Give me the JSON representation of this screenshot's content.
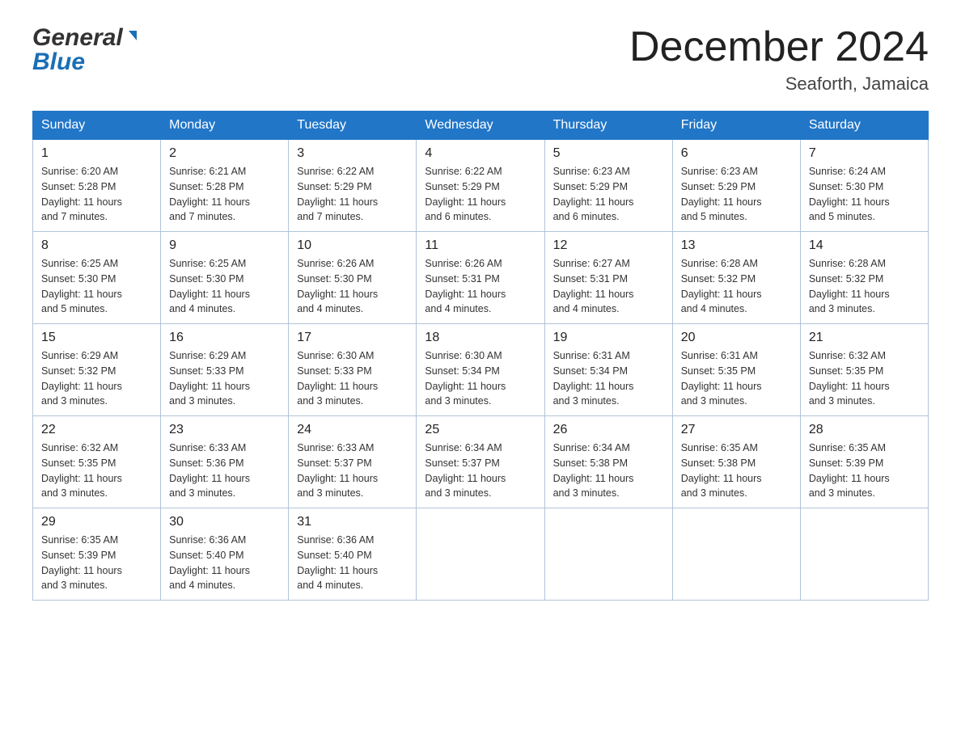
{
  "header": {
    "logo_general": "General",
    "logo_blue": "Blue",
    "title": "December 2024",
    "location": "Seaforth, Jamaica"
  },
  "days_of_week": [
    "Sunday",
    "Monday",
    "Tuesday",
    "Wednesday",
    "Thursday",
    "Friday",
    "Saturday"
  ],
  "weeks": [
    [
      {
        "day": "1",
        "sunrise": "6:20 AM",
        "sunset": "5:28 PM",
        "daylight": "11 hours and 7 minutes."
      },
      {
        "day": "2",
        "sunrise": "6:21 AM",
        "sunset": "5:28 PM",
        "daylight": "11 hours and 7 minutes."
      },
      {
        "day": "3",
        "sunrise": "6:22 AM",
        "sunset": "5:29 PM",
        "daylight": "11 hours and 7 minutes."
      },
      {
        "day": "4",
        "sunrise": "6:22 AM",
        "sunset": "5:29 PM",
        "daylight": "11 hours and 6 minutes."
      },
      {
        "day": "5",
        "sunrise": "6:23 AM",
        "sunset": "5:29 PM",
        "daylight": "11 hours and 6 minutes."
      },
      {
        "day": "6",
        "sunrise": "6:23 AM",
        "sunset": "5:29 PM",
        "daylight": "11 hours and 5 minutes."
      },
      {
        "day": "7",
        "sunrise": "6:24 AM",
        "sunset": "5:30 PM",
        "daylight": "11 hours and 5 minutes."
      }
    ],
    [
      {
        "day": "8",
        "sunrise": "6:25 AM",
        "sunset": "5:30 PM",
        "daylight": "11 hours and 5 minutes."
      },
      {
        "day": "9",
        "sunrise": "6:25 AM",
        "sunset": "5:30 PM",
        "daylight": "11 hours and 4 minutes."
      },
      {
        "day": "10",
        "sunrise": "6:26 AM",
        "sunset": "5:30 PM",
        "daylight": "11 hours and 4 minutes."
      },
      {
        "day": "11",
        "sunrise": "6:26 AM",
        "sunset": "5:31 PM",
        "daylight": "11 hours and 4 minutes."
      },
      {
        "day": "12",
        "sunrise": "6:27 AM",
        "sunset": "5:31 PM",
        "daylight": "11 hours and 4 minutes."
      },
      {
        "day": "13",
        "sunrise": "6:28 AM",
        "sunset": "5:32 PM",
        "daylight": "11 hours and 4 minutes."
      },
      {
        "day": "14",
        "sunrise": "6:28 AM",
        "sunset": "5:32 PM",
        "daylight": "11 hours and 3 minutes."
      }
    ],
    [
      {
        "day": "15",
        "sunrise": "6:29 AM",
        "sunset": "5:32 PM",
        "daylight": "11 hours and 3 minutes."
      },
      {
        "day": "16",
        "sunrise": "6:29 AM",
        "sunset": "5:33 PM",
        "daylight": "11 hours and 3 minutes."
      },
      {
        "day": "17",
        "sunrise": "6:30 AM",
        "sunset": "5:33 PM",
        "daylight": "11 hours and 3 minutes."
      },
      {
        "day": "18",
        "sunrise": "6:30 AM",
        "sunset": "5:34 PM",
        "daylight": "11 hours and 3 minutes."
      },
      {
        "day": "19",
        "sunrise": "6:31 AM",
        "sunset": "5:34 PM",
        "daylight": "11 hours and 3 minutes."
      },
      {
        "day": "20",
        "sunrise": "6:31 AM",
        "sunset": "5:35 PM",
        "daylight": "11 hours and 3 minutes."
      },
      {
        "day": "21",
        "sunrise": "6:32 AM",
        "sunset": "5:35 PM",
        "daylight": "11 hours and 3 minutes."
      }
    ],
    [
      {
        "day": "22",
        "sunrise": "6:32 AM",
        "sunset": "5:35 PM",
        "daylight": "11 hours and 3 minutes."
      },
      {
        "day": "23",
        "sunrise": "6:33 AM",
        "sunset": "5:36 PM",
        "daylight": "11 hours and 3 minutes."
      },
      {
        "day": "24",
        "sunrise": "6:33 AM",
        "sunset": "5:37 PM",
        "daylight": "11 hours and 3 minutes."
      },
      {
        "day": "25",
        "sunrise": "6:34 AM",
        "sunset": "5:37 PM",
        "daylight": "11 hours and 3 minutes."
      },
      {
        "day": "26",
        "sunrise": "6:34 AM",
        "sunset": "5:38 PM",
        "daylight": "11 hours and 3 minutes."
      },
      {
        "day": "27",
        "sunrise": "6:35 AM",
        "sunset": "5:38 PM",
        "daylight": "11 hours and 3 minutes."
      },
      {
        "day": "28",
        "sunrise": "6:35 AM",
        "sunset": "5:39 PM",
        "daylight": "11 hours and 3 minutes."
      }
    ],
    [
      {
        "day": "29",
        "sunrise": "6:35 AM",
        "sunset": "5:39 PM",
        "daylight": "11 hours and 3 minutes."
      },
      {
        "day": "30",
        "sunrise": "6:36 AM",
        "sunset": "5:40 PM",
        "daylight": "11 hours and 4 minutes."
      },
      {
        "day": "31",
        "sunrise": "6:36 AM",
        "sunset": "5:40 PM",
        "daylight": "11 hours and 4 minutes."
      },
      null,
      null,
      null,
      null
    ]
  ],
  "labels": {
    "sunrise": "Sunrise:",
    "sunset": "Sunset:",
    "daylight": "Daylight:"
  }
}
